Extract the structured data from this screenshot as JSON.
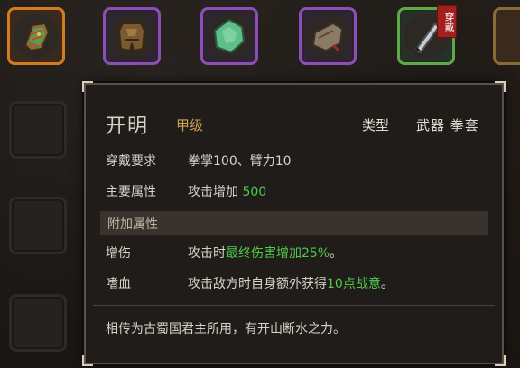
{
  "inventory": {
    "equipped_badge": "穿戴"
  },
  "tooltip": {
    "name": "开明",
    "grade": "甲级",
    "type_label": "类型",
    "type_value": "武器 拳套",
    "requirement_label": "穿戴要求",
    "requirement_value": "拳掌100、臂力10",
    "main_attr_label": "主要属性",
    "main_attr_text": "攻击增加",
    "main_attr_value": "500",
    "extra_section_title": "附加属性",
    "effects": [
      {
        "label": "增伤",
        "prefix": "攻击时",
        "highlight": "最终伤害增加25%",
        "suffix": "。"
      },
      {
        "label": "嗜血",
        "prefix": "攻击敌方时自身额外获得",
        "highlight": "10点战意",
        "suffix": "。"
      }
    ],
    "lore": "相传为古蜀国君主所用，有开山断水之力。"
  },
  "colors": {
    "highlight_green": "#4ec94a",
    "grade_gold": "#cfa357",
    "rarity_orange": "#d47a23",
    "rarity_purple": "#8c4fb5",
    "rarity_green": "#5ea84a",
    "badge_red": "#a3201f"
  }
}
